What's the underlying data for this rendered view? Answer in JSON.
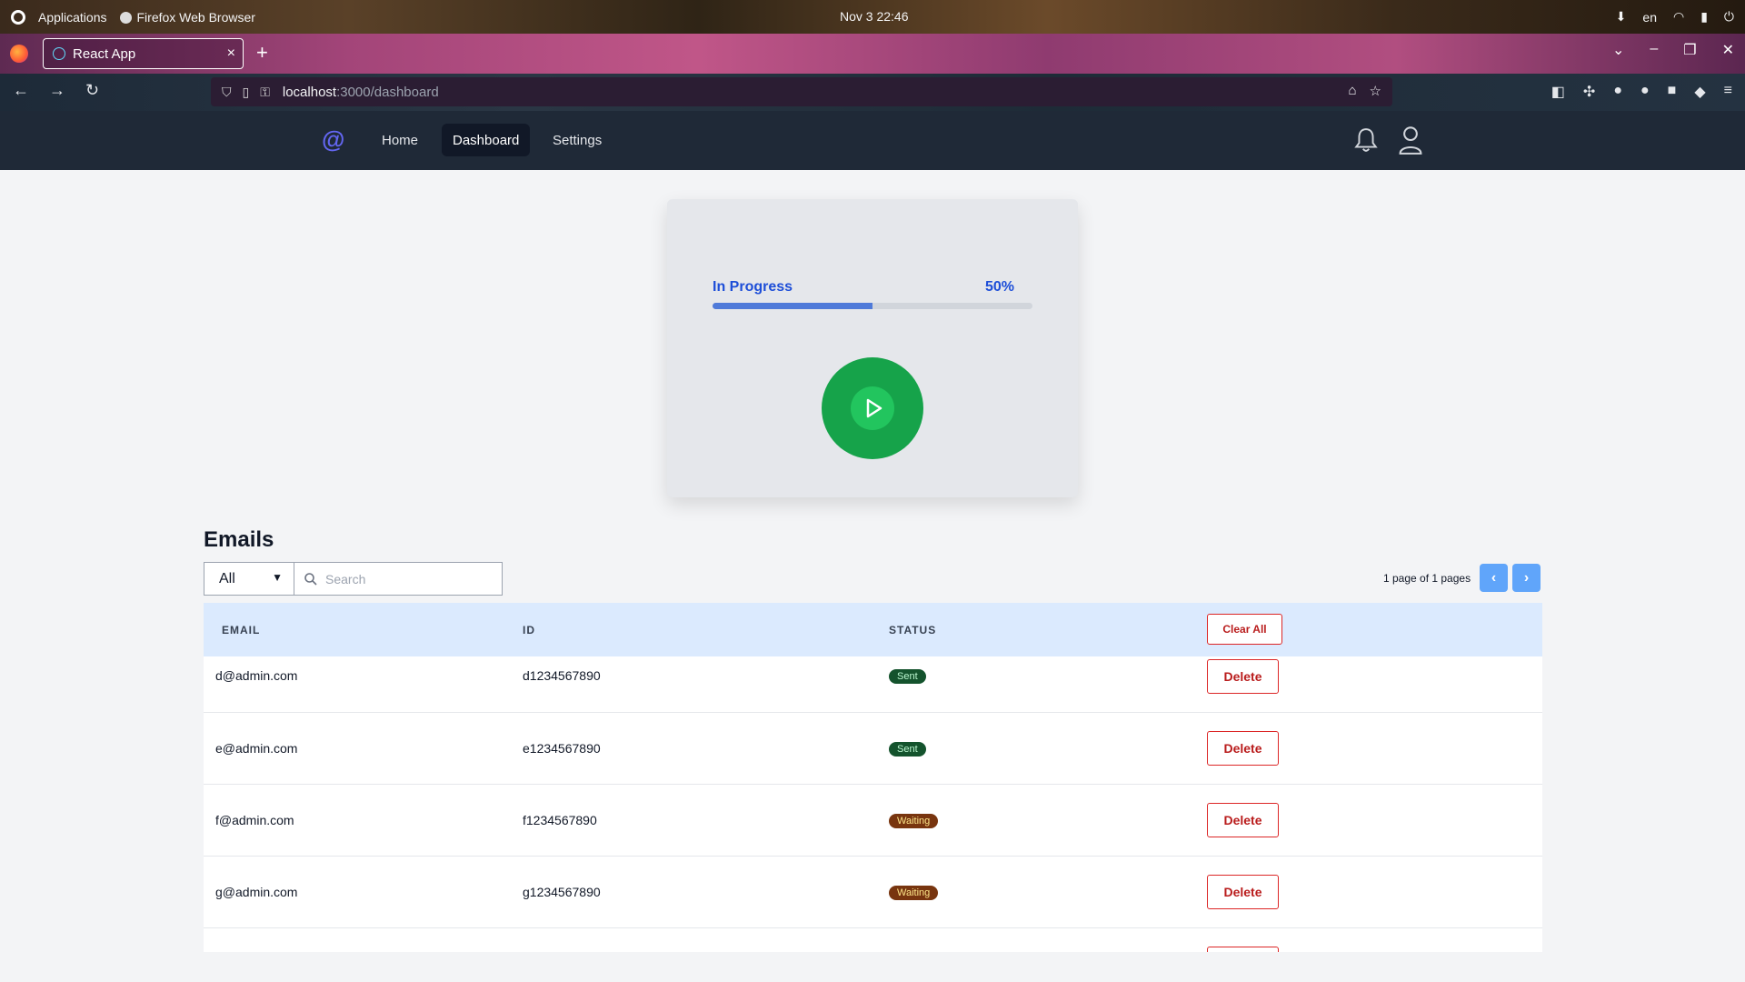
{
  "system": {
    "applications_label": "Applications",
    "browser_label": "Firefox Web Browser",
    "clock": "Nov 3  22:46",
    "lang": "en"
  },
  "browser": {
    "tab_title": "React App",
    "url_host": "localhost",
    "url_path": ":3000/dashboard"
  },
  "app": {
    "brand": "@",
    "nav": [
      {
        "label": "Home"
      },
      {
        "label": "Dashboard"
      },
      {
        "label": "Settings"
      }
    ],
    "active_nav": "Dashboard"
  },
  "progress": {
    "label": "In Progress",
    "percent_text": "50%",
    "value": 0.5
  },
  "emails": {
    "title": "Emails",
    "filter_value": "All",
    "search_placeholder": "Search",
    "pager_text": "1 page of 1 pages",
    "prev": "‹",
    "next": "›",
    "columns": {
      "email": "EMAIL",
      "id": "ID",
      "status": "STATUS"
    },
    "clear_all": "Clear All",
    "delete_label": "Delete",
    "rows": [
      {
        "email": "d@admin.com",
        "id": "d1234567890",
        "status": "Sent"
      },
      {
        "email": "e@admin.com",
        "id": "e1234567890",
        "status": "Sent"
      },
      {
        "email": "f@admin.com",
        "id": "f1234567890",
        "status": "Waiting"
      },
      {
        "email": "g@admin.com",
        "id": "g1234567890",
        "status": "Waiting"
      }
    ]
  },
  "colors": {
    "accent": "#1d4ed8",
    "play": "#16a34a",
    "danger": "#dc2626",
    "header_bg": "#1f2937"
  }
}
